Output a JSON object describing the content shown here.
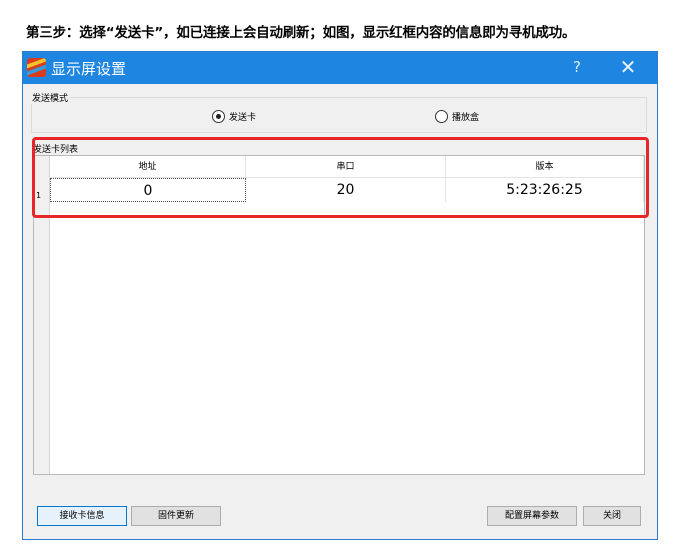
{
  "instruction": "第三步：选择“发送卡”，如已连接上会自动刷新；如图，显示红框内容的信息即为寻机成功。",
  "window": {
    "title": "显示屏设置",
    "help_label": "?",
    "close_label": "✕"
  },
  "send_mode": {
    "label": "发送模式",
    "options": [
      {
        "label": "发送卡",
        "checked": true
      },
      {
        "label": "播放盒",
        "checked": false
      }
    ]
  },
  "card_list": {
    "label": "发送卡列表",
    "columns": [
      "地址",
      "串口",
      "版本"
    ],
    "rows": [
      {
        "row_number": "1",
        "address": "0",
        "port": "20",
        "version": "5:23:26:25"
      }
    ]
  },
  "buttons": {
    "receive_info": "接收卡信息",
    "firmware_update": "固件更新",
    "config_screen": "配置屏幕参数",
    "close": "关闭"
  },
  "colors": {
    "titlebar": "#1e86e0",
    "highlight_border": "#e8262a"
  },
  "icons": {
    "app": "app-logo-icon",
    "help": "help-icon",
    "close": "close-icon"
  }
}
